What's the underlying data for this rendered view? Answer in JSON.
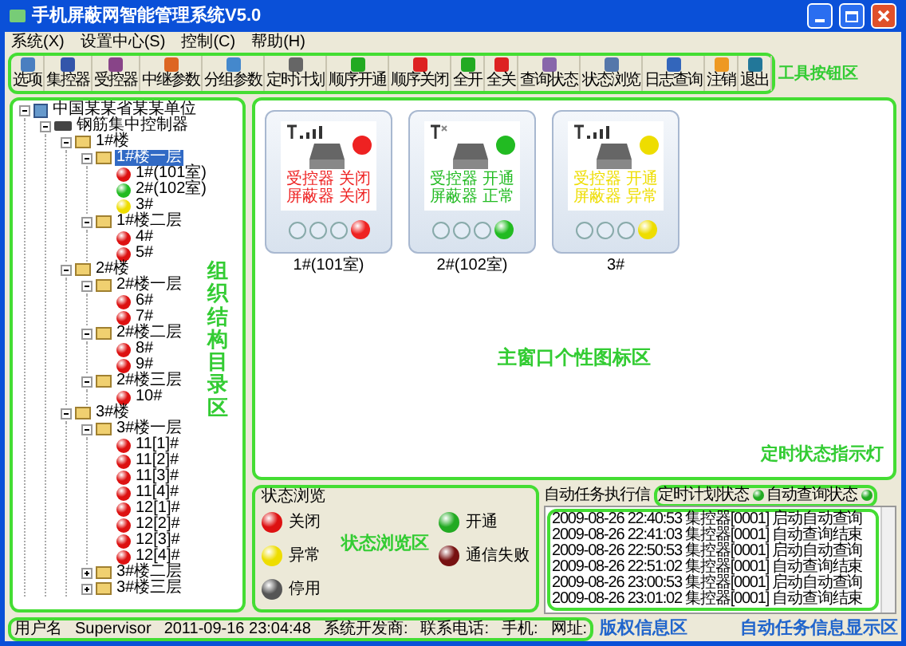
{
  "window": {
    "title": "手机屏蔽网智能管理系统V5.0"
  },
  "menu": [
    "系统(X)",
    "设置中心(S)",
    "控制(C)",
    "帮助(H)"
  ],
  "toolbar": [
    "选项",
    "集控器",
    "受控器",
    "中继参数",
    "分组参数",
    "定时计划",
    "顺序开通",
    "顺序关闭",
    "全开",
    "全关",
    "查询状态",
    "状态浏览",
    "日志查询",
    "注销",
    "退出"
  ],
  "tree": [
    {
      "label": "中国某某省某某单位",
      "kind": "root",
      "expanded": true,
      "selected": false,
      "children": [
        {
          "label": "钢筋集中控制器",
          "kind": "controller",
          "expanded": true,
          "selected": false,
          "children": [
            {
              "label": "1#楼",
              "kind": "folder",
              "expanded": true,
              "selected": false,
              "children": [
                {
                  "label": "1#楼一层",
                  "kind": "folder",
                  "expanded": true,
                  "selected": true,
                  "children": [
                    {
                      "label": "1#(101室)",
                      "kind": "device",
                      "color": "#dd1111",
                      "selected": false
                    },
                    {
                      "label": "2#(102室)",
                      "kind": "device",
                      "color": "#22bb22",
                      "selected": false
                    },
                    {
                      "label": "3#",
                      "kind": "device",
                      "color": "#eedd00",
                      "selected": false
                    }
                  ]
                },
                {
                  "label": "1#楼二层",
                  "kind": "folder",
                  "expanded": true,
                  "selected": false,
                  "children": [
                    {
                      "label": "4#",
                      "kind": "device",
                      "color": "#dd1111",
                      "selected": false
                    },
                    {
                      "label": "5#",
                      "kind": "device",
                      "color": "#dd1111",
                      "selected": false
                    }
                  ]
                }
              ]
            },
            {
              "label": "2#楼",
              "kind": "folder",
              "expanded": true,
              "selected": false,
              "children": [
                {
                  "label": "2#楼一层",
                  "kind": "folder",
                  "expanded": true,
                  "selected": false,
                  "children": [
                    {
                      "label": "6#",
                      "kind": "device",
                      "color": "#dd1111",
                      "selected": false
                    },
                    {
                      "label": "7#",
                      "kind": "device",
                      "color": "#dd1111",
                      "selected": false
                    }
                  ]
                },
                {
                  "label": "2#楼二层",
                  "kind": "folder",
                  "expanded": true,
                  "selected": false,
                  "children": [
                    {
                      "label": "8#",
                      "kind": "device",
                      "color": "#dd1111",
                      "selected": false
                    },
                    {
                      "label": "9#",
                      "kind": "device",
                      "color": "#dd1111",
                      "selected": false
                    }
                  ]
                },
                {
                  "label": "2#楼三层",
                  "kind": "folder",
                  "expanded": true,
                  "selected": false,
                  "children": [
                    {
                      "label": "10#",
                      "kind": "device",
                      "color": "#dd1111",
                      "selected": false
                    }
                  ]
                }
              ]
            },
            {
              "label": "3#楼",
              "kind": "folder",
              "expanded": true,
              "selected": false,
              "children": [
                {
                  "label": "3#楼一层",
                  "kind": "folder",
                  "expanded": true,
                  "selected": false,
                  "children": [
                    {
                      "label": "11[1]#",
                      "kind": "device",
                      "color": "#dd1111",
                      "selected": false
                    },
                    {
                      "label": "11[2]#",
                      "kind": "device",
                      "color": "#dd1111",
                      "selected": false
                    },
                    {
                      "label": "11[3]#",
                      "kind": "device",
                      "color": "#dd1111",
                      "selected": false
                    },
                    {
                      "label": "11[4]#",
                      "kind": "device",
                      "color": "#dd1111",
                      "selected": false
                    },
                    {
                      "label": "12[1]#",
                      "kind": "device",
                      "color": "#dd1111",
                      "selected": false
                    },
                    {
                      "label": "12[2]#",
                      "kind": "device",
                      "color": "#dd1111",
                      "selected": false
                    },
                    {
                      "label": "12[3]#",
                      "kind": "device",
                      "color": "#dd1111",
                      "selected": false
                    },
                    {
                      "label": "12[4]#",
                      "kind": "device",
                      "color": "#dd1111",
                      "selected": false
                    }
                  ]
                },
                {
                  "label": "3#楼二层",
                  "kind": "folder",
                  "expanded": false,
                  "selected": false
                },
                {
                  "label": "3#楼三层",
                  "kind": "folder",
                  "expanded": false,
                  "selected": false
                }
              ]
            }
          ]
        }
      ]
    }
  ],
  "devices": [
    {
      "name": "1#(101室)",
      "color": "#ee2222",
      "signal": true,
      "lines": [
        [
          "受控器",
          "关闭"
        ],
        [
          "屏蔽器",
          "关闭"
        ]
      ]
    },
    {
      "name": "2#(102室)",
      "color": "#22bb22",
      "signal": false,
      "lines": [
        [
          "受控器",
          "开通"
        ],
        [
          "屏蔽器",
          "正常"
        ]
      ]
    },
    {
      "name": "3#",
      "color": "#eedd00",
      "signal": true,
      "lines": [
        [
          "受控器",
          "开通"
        ],
        [
          "屏蔽器",
          "异常"
        ]
      ]
    }
  ],
  "status_legend": {
    "title": "状态浏览",
    "items": [
      {
        "label": "关闭",
        "color": "#dd1111"
      },
      {
        "label": "开通",
        "color": "#22aa22"
      },
      {
        "label": "异常",
        "color": "#eedd00"
      },
      {
        "label": "通信失败",
        "color": "#771111"
      },
      {
        "label": "停用",
        "color": "#555555"
      }
    ]
  },
  "task_panel": {
    "title": "自动任务执行信",
    "indicators": [
      {
        "label": "定时计划状态",
        "color": "#22aa22"
      },
      {
        "label": "自动查询状态",
        "color": "#22aa22"
      }
    ],
    "log": [
      "2009-08-26 22:40:53 集控器[0001] 启动自动查询",
      "2009-08-26 22:41:03 集控器[0001] 自动查询结束",
      "2009-08-26 22:50:53 集控器[0001] 启动自动查询",
      "2009-08-26 22:51:02 集控器[0001] 自动查询结束",
      "2009-08-26 23:00:53 集控器[0001] 启动自动查询",
      "2009-08-26 23:01:02 集控器[0001] 自动查询结束"
    ]
  },
  "status_bar": [
    "用户名",
    "Supervisor",
    "2011-09-16 23:04:48",
    "系统开发商:",
    "联系电话:",
    "手机:",
    "网址:"
  ],
  "annotations": {
    "toolbar": "工具按钮区",
    "tree": "组织结构目录区",
    "icons": "主窗口个性图标区",
    "timer": "定时状态指示灯",
    "legend": "状态浏览区",
    "tasks": "自动任务信息显示区",
    "copyright": "版权信息区"
  }
}
